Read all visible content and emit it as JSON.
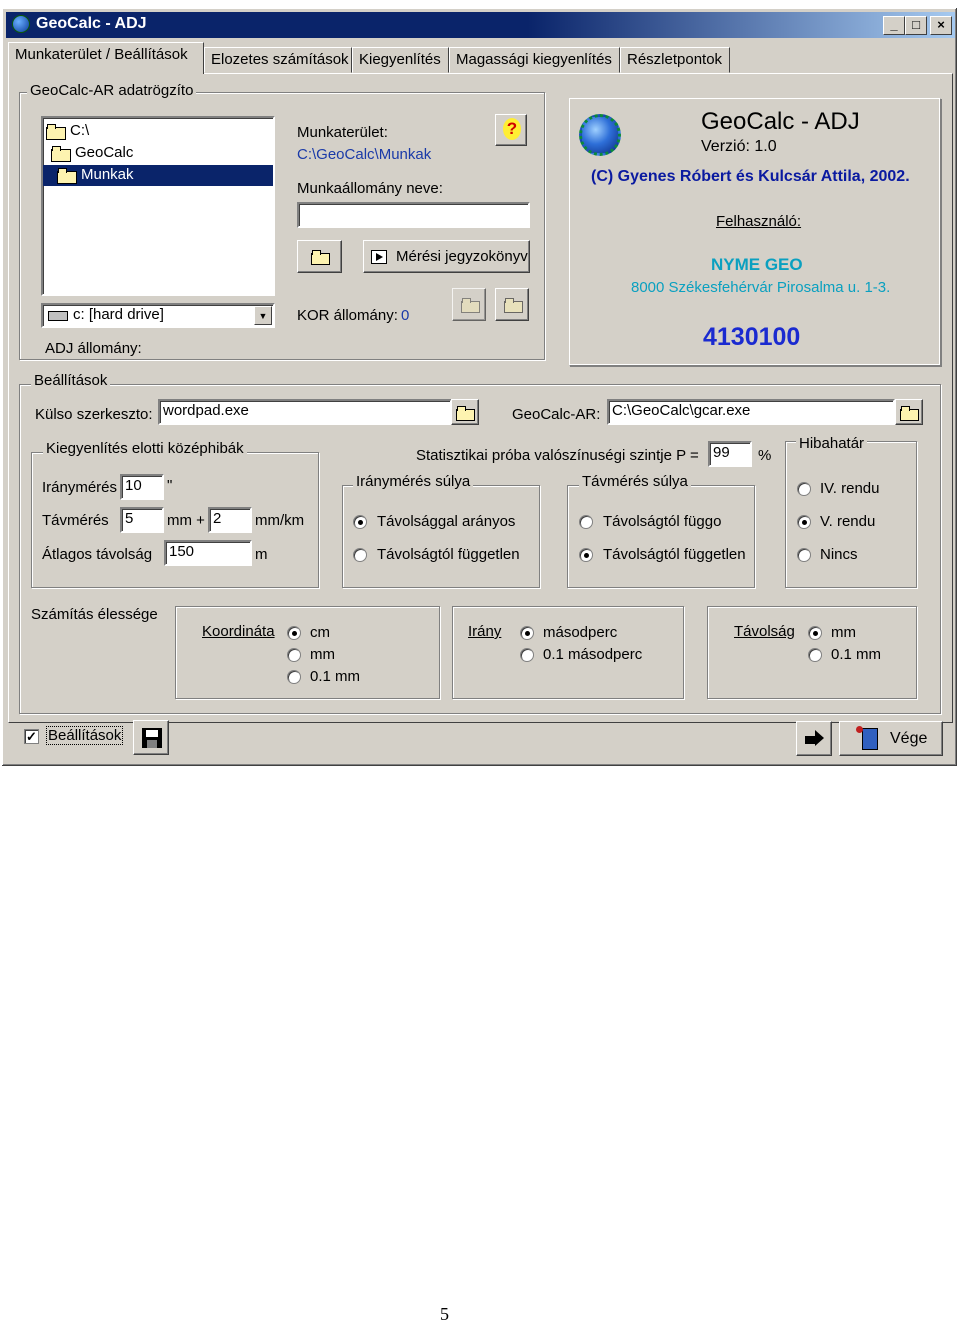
{
  "window": {
    "title": "GeoCalc - ADJ",
    "minimize": "_",
    "maximize": "□",
    "close": "×"
  },
  "tabs": [
    {
      "label": "Munkaterület / Beállítások"
    },
    {
      "label": "Elozetes számítások"
    },
    {
      "label": "Kiegyenlítés"
    },
    {
      "label": "Magassági kiegyenlítés"
    },
    {
      "label": "Részletpontok"
    }
  ],
  "recorder_group": {
    "title": "GeoCalc-AR adatrögzíto",
    "tree": [
      "C:\\",
      "GeoCalc",
      "Munkak"
    ],
    "drive": "c: [hard drive]",
    "adj_label": "ADJ állomány:",
    "workspace_label": "Munkaterület:",
    "workspace_path": "C:\\GeoCalc\\Munkak",
    "file_name_label": "Munkaállomány neve:",
    "file_name_value": "",
    "protocol_button": "Mérési jegyzokönyv",
    "kor_label": "KOR állomány:",
    "kor_value": "0",
    "help_glyph": "?"
  },
  "info": {
    "app_name": "GeoCalc - ADJ",
    "version": "Verzió: 1.0",
    "copyright": "(C) Gyenes Róbert és Kulcsár Attila, 2002.",
    "user_label": "Felhasználó:",
    "org": "NYME GEO",
    "address": "8000 Székesfehérvár Pirosalma u. 1-3.",
    "serial": "4130100"
  },
  "settings": {
    "title": "Beállítások",
    "editor_label": "Külso szerkeszto:",
    "editor_value": "wordpad.exe",
    "gcar_label": "GeoCalc-AR:",
    "gcar_value": "C:\\GeoCalc\\gcar.exe",
    "prior_errors": {
      "title": "Kiegyenlítés elotti középhibák",
      "direction_label": "Iránymérés",
      "direction_value": "10",
      "direction_unit": "\"",
      "distance_label": "Távmérés",
      "distance_value_a": "5",
      "distance_unit_a": "mm +",
      "distance_value_b": "2",
      "distance_unit_b": "mm/km",
      "avg_label": "Átlagos távolság",
      "avg_value": "150",
      "avg_unit": "m"
    },
    "stat_label": "Statisztikai próba valószínuségi szintje  P =",
    "stat_value": "99",
    "stat_unit": "%",
    "dir_weight": {
      "title": "Iránymérés súlya",
      "options": [
        "Távolsággal arányos",
        "Távolságtól független"
      ],
      "selected": 0
    },
    "dist_weight": {
      "title": "Távmérés súlya",
      "options": [
        "Távolságtól függo",
        "Távolságtól független"
      ],
      "selected": 1
    },
    "error_limit": {
      "title": "Hibahatár",
      "options": [
        "IV. rendu",
        "V. rendu",
        "Nincs"
      ],
      "selected": 1
    },
    "precision_label": "Számítás élessége",
    "coord": {
      "label": "Koordináta",
      "options": [
        "cm",
        "mm",
        "0.1 mm"
      ],
      "selected": 0
    },
    "direction": {
      "label": "Irány",
      "options": [
        "másodperc",
        "0.1 másodperc"
      ],
      "selected": 0
    },
    "distance": {
      "label": "Távolság",
      "options": [
        "mm",
        "0.1 mm"
      ],
      "selected": 0
    }
  },
  "bottom": {
    "settings_checkbox": "Beállítások",
    "settings_checked": true,
    "exit_label": "Vége"
  },
  "page_number": "5"
}
